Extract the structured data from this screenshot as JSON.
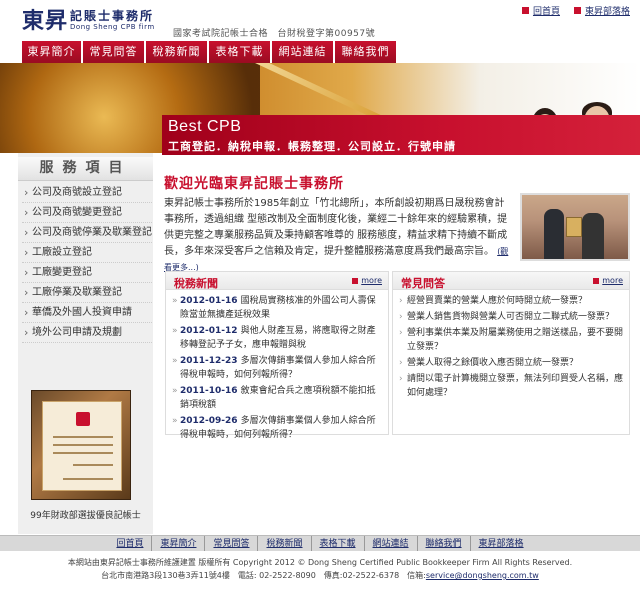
{
  "header": {
    "logo_main": "東昇",
    "logo_sub": "記賬士事務所",
    "logo_en": "Dong Sheng CPB firm",
    "tagline": "國家考試院記帳士合格　台財稅登字第00957號",
    "top_links": [
      {
        "label": "回首頁"
      },
      {
        "label": "東昇部落格"
      }
    ]
  },
  "nav": {
    "items": [
      {
        "label": "東昇簡介"
      },
      {
        "label": "常見問答"
      },
      {
        "label": "稅務新聞"
      },
      {
        "label": "表格下載"
      },
      {
        "label": "網站連結"
      },
      {
        "label": "聯絡我們"
      }
    ]
  },
  "banner": {
    "title": "Best CPB",
    "services": "工商登記．納稅申報．帳務整理．公司設立．行號申請"
  },
  "sidebar": {
    "title": "服務項目",
    "items": [
      {
        "label": "公司及商號設立登記"
      },
      {
        "label": "公司及商號變更登記"
      },
      {
        "label": "公司及商號停業及歇業登記"
      },
      {
        "label": "工廠設立登記"
      },
      {
        "label": "工廠變更登記"
      },
      {
        "label": "工廠停業及歇業登記"
      },
      {
        "label": "華僑及外國人投資申請"
      },
      {
        "label": "境外公司申請及規劃"
      }
    ],
    "cert_caption": "99年財政部選拔優良記帳士"
  },
  "welcome": {
    "title": "歡迎光臨東昇記賬士事務所",
    "body": "東昇記帳士事務所於1985年創立「竹北總所」，本所創設初期爲日晟稅務會計事務所，透過組織 型態改制及全面制度化後，業經二十餘年來的經驗累積，提供更完整之專業服務品質及秉持顧客唯尊的 服務態度，精益求精下持續不斷成長，多年來深受客戶之信賴及肯定，提升整體服務滿意度爲我們最高宗旨。",
    "more": "(觀看更多...)"
  },
  "news": {
    "title": "稅務新聞",
    "more": "more",
    "items": [
      {
        "date": "2012-01-16",
        "text": "國稅局實務核准的外國公司人壽保險當並無擴產延稅效果"
      },
      {
        "date": "2012-01-12",
        "text": "與他人財產互易，將應取得之財產移轉登記予子女，應申報贈與稅"
      },
      {
        "date": "2011-12-23",
        "text": "多層次傳銷事業個人參加人綜合所得稅申報時，如何列報所得？"
      },
      {
        "date": "2011-10-16",
        "text": "敘東會紀合兵之應項稅額不能扣抵銷項稅額"
      },
      {
        "date": "2012-09-26",
        "text": "多層次傳銷事業個人參加人綜合所得稅申報時，如何列報所得？"
      }
    ]
  },
  "faq": {
    "title": "常見問答",
    "more": "more",
    "items": [
      {
        "text": "經營買賣業的營業人應於何時開立統一發票？"
      },
      {
        "text": "營業人銷售貨物與營業人可否開立二聯式統一發票？"
      },
      {
        "text": "營利事業供本業及附屬業務使用之贈送樣品，要不要開立發票？"
      },
      {
        "text": "營業人取得之餘價收入應否開立統一發票？"
      },
      {
        "text": "請問以電子計算機開立發票，無法列印買受人名稱，應如何處理？"
      }
    ]
  },
  "footer": {
    "links": [
      {
        "label": "回首頁"
      },
      {
        "label": "東昇簡介"
      },
      {
        "label": "常見問答"
      },
      {
        "label": "稅務新聞"
      },
      {
        "label": "表格下載"
      },
      {
        "label": "網站連結"
      },
      {
        "label": "聯絡我們"
      },
      {
        "label": "東昇部落格"
      }
    ],
    "line1": "本網站由東昇記帳士事務所維護建置 版權所有 Copyright 2012 © Dong Sheng Certified Public Bookkeeper Firm All Rights Reserved.",
    "line2_prefix": "台北市南港路3段130巷3弄11號4樓　電話: 02-2522-8090　傳真:02-2522-6378　信箱:",
    "email": "service@dongsheng.com.tw"
  },
  "colors": {
    "accent_red": "#c8102e",
    "brand_navy": "#1e2c6b"
  }
}
